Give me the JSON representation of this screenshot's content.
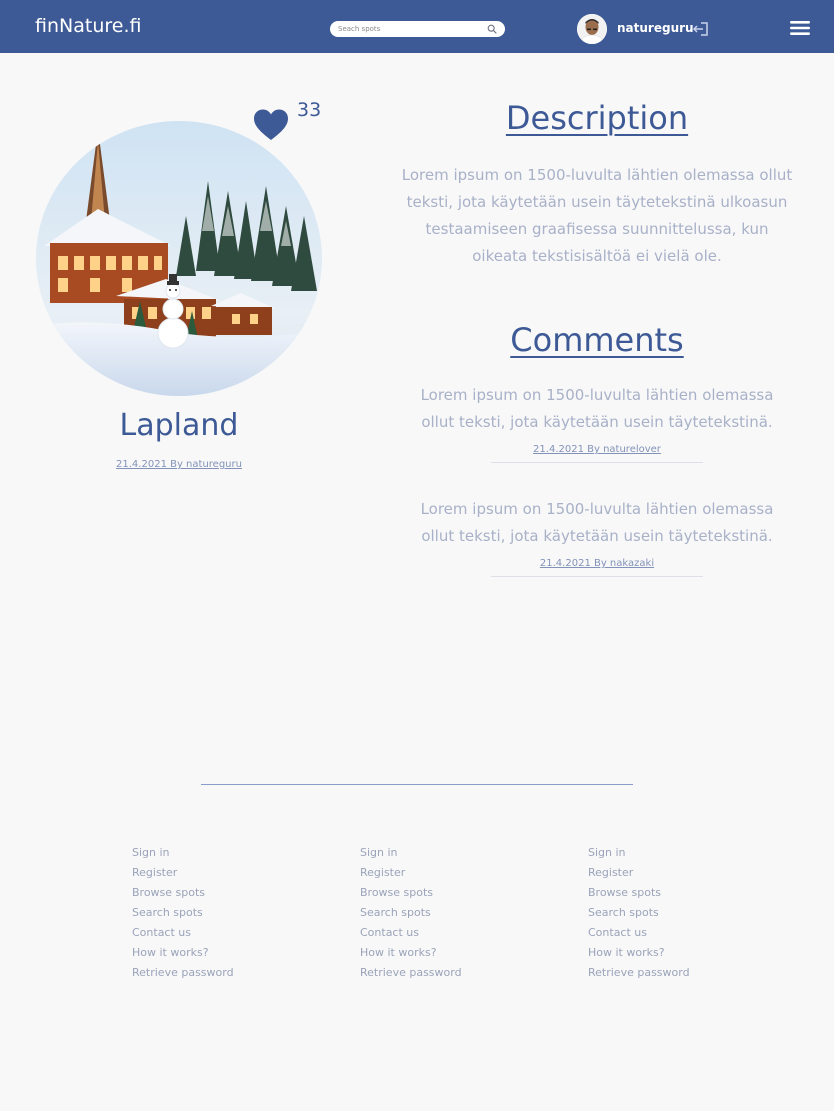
{
  "header": {
    "logo": "finNature.fi",
    "search_placeholder": "Seach spots",
    "username": "natureguru",
    "accent_color": "#3d5a96"
  },
  "spot": {
    "likes": "33",
    "title": "Lapland",
    "meta": "21.4.2021 By natureguru"
  },
  "description": {
    "heading": "Description",
    "text": "Lorem ipsum on 1500-luvulta lähtien olemassa ollut teksti, jota käytetään usein täytetekstinä ulkoasun testaamiseen graafisessa suunnittelussa, kun oikeata tekstisisältöä ei vielä ole."
  },
  "comments": {
    "heading": "Comments",
    "items": [
      {
        "text": "Lorem ipsum on 1500-luvulta lähtien olemassa ollut teksti, jota käytetään usein täytetekstinä.",
        "meta": "21.4.2021 By naturelover"
      },
      {
        "text": "Lorem ipsum on 1500-luvulta lähtien olemassa ollut teksti, jota käytetään usein täytetekstinä.",
        "meta": "21.4.2021 By nakazaki"
      }
    ]
  },
  "footer": {
    "columns": [
      [
        "Sign in",
        "Register",
        "Browse spots",
        "Search spots",
        "Contact us",
        "How it works?",
        "Retrieve password"
      ],
      [
        "Sign in",
        "Register",
        "Browse spots",
        "Search spots",
        "Contact us",
        "How it works?",
        "Retrieve password"
      ],
      [
        "Sign in",
        "Register",
        "Browse spots",
        "Search spots",
        "Contact us",
        "How it works?",
        "Retrieve password"
      ]
    ]
  },
  "icons": [
    "search-icon",
    "logout-icon",
    "menu-icon",
    "heart-icon"
  ]
}
